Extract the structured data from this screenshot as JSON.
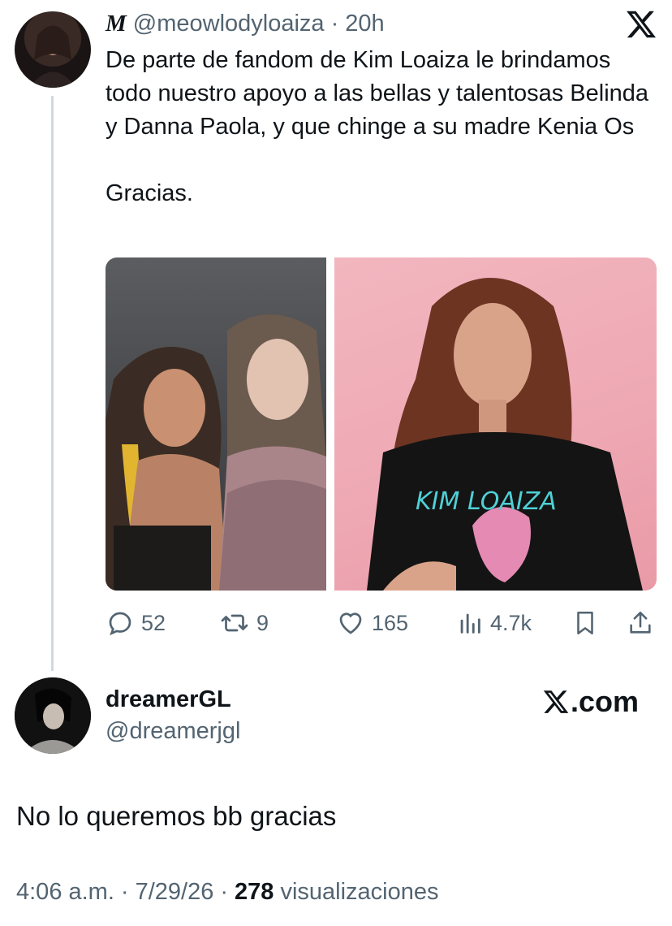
{
  "tweet": {
    "display_name": "M",
    "handle": "@meowlodyloaiza",
    "separator": "·",
    "time": "20h",
    "text": "De parte de fandom de Kim Loaiza le brindamos todo nuestro apoyo a las bellas y talentosas Belinda y Danna Paola, y que chinge a su madre Kenia Os\n\nGracias.",
    "media": [
      {
        "icon": "photo-two-women"
      },
      {
        "icon": "photo-woman-tshirt",
        "shirt_text": "KIM LOAIZA"
      }
    ],
    "actions": {
      "replies": "52",
      "retweets": "9",
      "likes": "165",
      "views": "4.7k"
    }
  },
  "reply": {
    "display_name": "dreamerGL",
    "handle": "@dreamerjgl",
    "brand": ".com",
    "text": "No lo queremos bb gracias",
    "time": "4:06 a.m.",
    "separator": "·",
    "date": "7/29/26",
    "views_count": "278",
    "views_label": "visualizaciones"
  },
  "colors": {
    "text": "#0f1419",
    "secondary": "#536471",
    "thread_line": "#cfd9de",
    "pink_bg": "#eea8b3"
  }
}
